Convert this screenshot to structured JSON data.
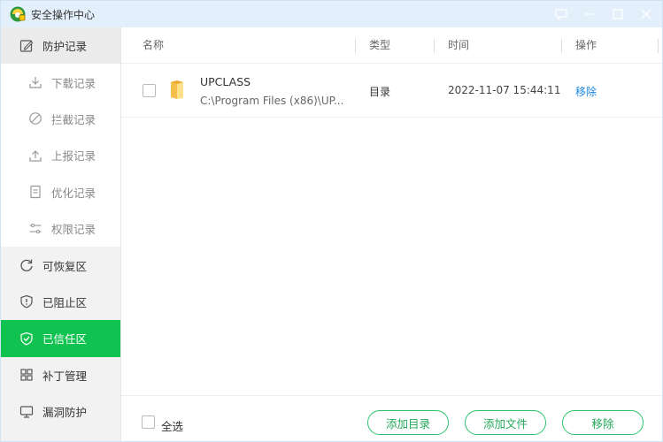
{
  "window": {
    "title": "安全操作中心"
  },
  "sidebar": {
    "items": [
      {
        "label": "防护记录",
        "icon": "edit-record-icon",
        "kind": "top"
      },
      {
        "label": "下载记录",
        "icon": "download-icon",
        "kind": "sub"
      },
      {
        "label": "拦截记录",
        "icon": "block-icon",
        "kind": "sub"
      },
      {
        "label": "上报记录",
        "icon": "upload-icon",
        "kind": "sub"
      },
      {
        "label": "优化记录",
        "icon": "document-icon",
        "kind": "sub"
      },
      {
        "label": "权限记录",
        "icon": "sliders-icon",
        "kind": "sub"
      },
      {
        "label": "可恢复区",
        "icon": "restore-icon",
        "kind": "top"
      },
      {
        "label": "已阻止区",
        "icon": "shield-alert-icon",
        "kind": "top"
      },
      {
        "label": "已信任区",
        "icon": "shield-check-icon",
        "kind": "top",
        "active": true
      },
      {
        "label": "补丁管理",
        "icon": "grid-icon",
        "kind": "top"
      },
      {
        "label": "漏洞防护",
        "icon": "monitor-icon",
        "kind": "top"
      }
    ]
  },
  "table": {
    "columns": [
      "名称",
      "类型",
      "时间",
      "操作"
    ],
    "rows": [
      {
        "name": "UPCLASS",
        "path": "C:\\Program Files (x86)\\UP...",
        "type": "目录",
        "time": "2022-11-07 15:44:11",
        "action": "移除"
      }
    ]
  },
  "footer": {
    "select_all": "全选",
    "add_dir": "添加目录",
    "add_file": "添加文件",
    "remove": "移除"
  },
  "colors": {
    "accent": "#10c351",
    "link": "#1e88e5",
    "titlebar": "#e3f0fb"
  }
}
